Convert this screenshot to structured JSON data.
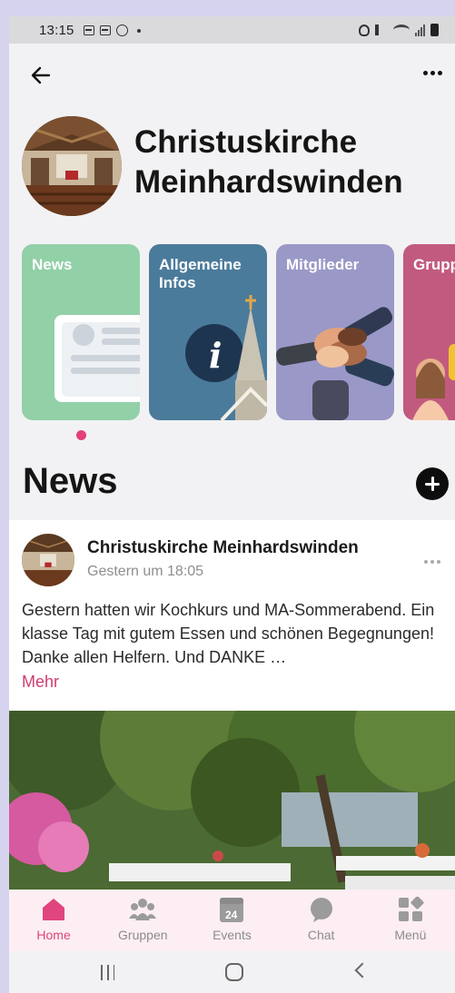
{
  "status_bar": {
    "time": "13:15"
  },
  "group": {
    "name": "Christuskirche Meinhardswinden"
  },
  "cards": [
    {
      "label": "News"
    },
    {
      "label": "Allgemeine Infos"
    },
    {
      "label": "Mitglieder"
    },
    {
      "label": "Grupp"
    }
  ],
  "news_section": {
    "title": "News"
  },
  "post": {
    "author": "Christuskirche Meinhardswinden",
    "time": "Gestern um 18:05",
    "text": "Gestern hatten wir Kochkurs und MA-Sommerabend. Ein klasse Tag mit gutem Essen und schönen Begegnungen! Danke allen Helfern. Und DANKE …",
    "more_label": "Mehr"
  },
  "tabbar": {
    "items": [
      {
        "label": "Home",
        "icon": "home-icon",
        "active": true
      },
      {
        "label": "Gruppen",
        "icon": "groups-icon"
      },
      {
        "label": "Events",
        "icon": "calendar-icon",
        "calendar_day": "24"
      },
      {
        "label": "Chat",
        "icon": "chat-icon"
      },
      {
        "label": "Menü",
        "icon": "menu-grid-icon"
      }
    ]
  },
  "colors": {
    "accent": "#e0457e",
    "news_card": "#92d0a8",
    "info_card": "#4b7b9b",
    "members_card": "#9a98c7",
    "groups_card": "#c25a7f"
  }
}
